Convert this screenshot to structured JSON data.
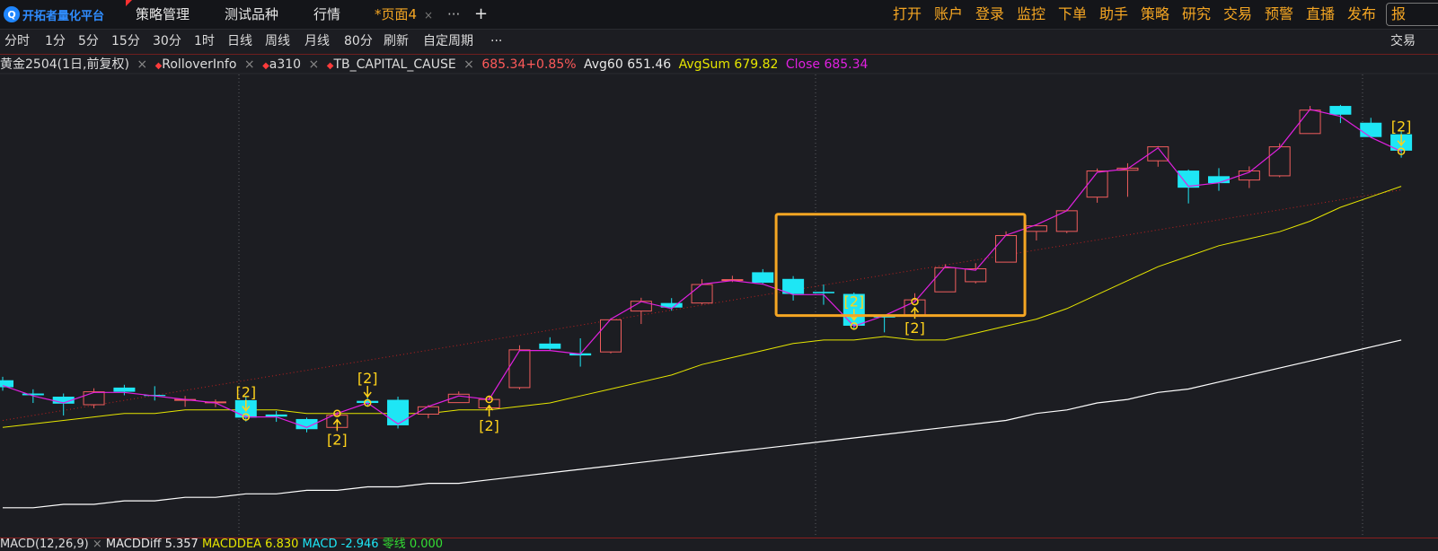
{
  "app": {
    "logo_text": "开拓者量化平台",
    "logo_icon": "q-logo-icon"
  },
  "tabs": [
    {
      "label": "策略管理",
      "active": false
    },
    {
      "label": "测试品种",
      "active": false
    },
    {
      "label": "行情",
      "active": false
    },
    {
      "label": "*页面4",
      "active": true,
      "closable": true
    }
  ],
  "tab_more": "···",
  "tab_add": "+",
  "close_glyph": "×",
  "right_menu": [
    "打开",
    "账户",
    "登录",
    "监控",
    "下单",
    "助手",
    "策略",
    "研究",
    "交易",
    "预警",
    "直播",
    "发布"
  ],
  "right_menu_cut": "报",
  "periods": [
    "分时",
    "1分",
    "5分",
    "15分",
    "30分",
    "1时",
    "日线",
    "周线",
    "月线",
    "80分",
    "刷新",
    "自定周期",
    "···"
  ],
  "period_right": "交易",
  "legend": {
    "symbol": "黄金2504(1日,前复权)",
    "indicators": [
      "RolloverInfo",
      "a310",
      "TB_CAPITAL_CAUSE"
    ],
    "price_change": "685.34+0.85%",
    "avg60": "Avg60 651.46",
    "avgsum": "AvgSum 679.82",
    "close": "Close 685.34",
    "colors": {
      "price_change": "#ff5a5a",
      "avg60": "#e8e8e8",
      "avgsum": "#e6e600",
      "close": "#e020e0"
    }
  },
  "macd_legend": {
    "name": "MACD(12,26,9)",
    "diff": "MACDDiff 5.357",
    "dea": "MACDDEA 6.830",
    "macd": "MACD -2.946",
    "zero": "零线 0.000"
  },
  "chart_data": {
    "type": "candlestick",
    "symbol": "黄金2504",
    "period": "1日",
    "candles": [
      {
        "o": 609.5,
        "h": 610.5,
        "l": 606.5,
        "c": 607.5
      },
      {
        "o": 605.7,
        "h": 606.9,
        "l": 603.0,
        "c": 605.2
      },
      {
        "o": 604.8,
        "h": 605.7,
        "l": 599.4,
        "c": 602.8
      },
      {
        "o": 602.5,
        "h": 607.2,
        "l": 601.5,
        "c": 606.2
      },
      {
        "o": 607.4,
        "h": 608.2,
        "l": 605.2,
        "c": 606.2
      },
      {
        "o": 605.3,
        "h": 607.8,
        "l": 603.7,
        "c": 605.0
      },
      {
        "o": 603.8,
        "h": 605.0,
        "l": 601.9,
        "c": 604.0
      },
      {
        "o": 603.1,
        "h": 604.0,
        "l": 601.8,
        "c": 603.3
      },
      {
        "o": 603.8,
        "h": 604.7,
        "l": 597.7,
        "c": 598.8
      },
      {
        "o": 599.7,
        "h": 600.7,
        "l": 597.6,
        "c": 599.1
      },
      {
        "o": 598.4,
        "h": 598.8,
        "l": 594.6,
        "c": 595.5
      },
      {
        "o": 596.0,
        "h": 600.4,
        "l": 594.9,
        "c": 599.5
      },
      {
        "o": 603.6,
        "h": 604.5,
        "l": 601.9,
        "c": 603.0
      },
      {
        "o": 603.9,
        "h": 604.8,
        "l": 595.7,
        "c": 596.6
      },
      {
        "o": 599.8,
        "h": 602.4,
        "l": 598.6,
        "c": 601.9
      },
      {
        "o": 603.1,
        "h": 606.3,
        "l": 603.1,
        "c": 605.5
      },
      {
        "o": 601.6,
        "h": 605.2,
        "l": 601.3,
        "c": 604.0
      },
      {
        "o": 607.4,
        "h": 619.5,
        "l": 606.9,
        "c": 618.2
      },
      {
        "o": 620.0,
        "h": 621.8,
        "l": 618.2,
        "c": 618.5
      },
      {
        "o": 617.2,
        "h": 621.5,
        "l": 613.4,
        "c": 616.6
      },
      {
        "o": 617.6,
        "h": 627.2,
        "l": 617.2,
        "c": 626.8
      },
      {
        "o": 629.3,
        "h": 633.1,
        "l": 625.6,
        "c": 632.1
      },
      {
        "o": 631.6,
        "h": 633.0,
        "l": 629.4,
        "c": 630.3
      },
      {
        "o": 631.6,
        "h": 638.4,
        "l": 631.2,
        "c": 636.9
      },
      {
        "o": 638.1,
        "h": 639.4,
        "l": 637.6,
        "c": 638.3
      },
      {
        "o": 640.4,
        "h": 641.3,
        "l": 637.2,
        "c": 637.4
      },
      {
        "o": 638.5,
        "h": 639.3,
        "l": 632.3,
        "c": 634.2
      },
      {
        "o": 634.8,
        "h": 636.9,
        "l": 631.1,
        "c": 634.4
      },
      {
        "o": 634.2,
        "h": 634.6,
        "l": 624.2,
        "c": 625.1
      },
      {
        "o": 627.7,
        "h": 628.3,
        "l": 623.2,
        "c": 627.6
      },
      {
        "o": 628.2,
        "h": 634.4,
        "l": 627.3,
        "c": 632.5
      },
      {
        "o": 634.8,
        "h": 642.7,
        "l": 634.8,
        "c": 641.7
      },
      {
        "o": 637.7,
        "h": 643.0,
        "l": 637.2,
        "c": 641.4
      },
      {
        "o": 643.3,
        "h": 652.1,
        "l": 643.3,
        "c": 650.9
      },
      {
        "o": 652.1,
        "h": 653.7,
        "l": 649.5,
        "c": 653.7
      },
      {
        "o": 652.1,
        "h": 658.4,
        "l": 651.6,
        "c": 658.0
      },
      {
        "o": 661.9,
        "h": 670.1,
        "l": 660.3,
        "c": 669.4
      },
      {
        "o": 669.6,
        "h": 671.6,
        "l": 662.0,
        "c": 670.2
      },
      {
        "o": 672.3,
        "h": 676.5,
        "l": 670.6,
        "c": 676.3
      },
      {
        "o": 669.5,
        "h": 669.8,
        "l": 660.1,
        "c": 664.6
      },
      {
        "o": 667.9,
        "h": 670.2,
        "l": 663.7,
        "c": 665.9
      },
      {
        "o": 666.8,
        "h": 670.7,
        "l": 664.5,
        "c": 669.4
      },
      {
        "o": 668.0,
        "h": 677.3,
        "l": 667.6,
        "c": 676.3
      },
      {
        "o": 680.1,
        "h": 688.0,
        "l": 680.1,
        "c": 686.8
      },
      {
        "o": 688.0,
        "h": 688.3,
        "l": 683.1,
        "c": 685.5
      },
      {
        "o": 683.2,
        "h": 684.6,
        "l": 678.9,
        "c": 679.1
      },
      {
        "o": 679.9,
        "h": 680.8,
        "l": 673.2,
        "c": 675.2
      }
    ],
    "series": [
      {
        "name": "Close",
        "values": [
          608,
          605,
          603,
          606,
          606,
          605,
          604,
          603,
          599,
          599,
          596,
          600,
          603,
          597,
          602,
          605,
          604,
          618,
          618,
          617,
          627,
          632,
          630,
          637,
          638,
          637,
          634,
          634,
          625,
          628,
          632,
          642,
          641,
          651,
          654,
          658,
          669,
          670,
          676,
          665,
          666,
          669,
          676,
          687,
          685,
          679,
          675
        ]
      },
      {
        "name": "AvgSum",
        "values": [
          596,
          597,
          598,
          599,
          600,
          600,
          601,
          601,
          601,
          601,
          600,
          600,
          600,
          600,
          600,
          601,
          601,
          602,
          603,
          605,
          607,
          609,
          611,
          614,
          616,
          618,
          620,
          621,
          621,
          622,
          621,
          621,
          623,
          625,
          627,
          630,
          634,
          638,
          642,
          645,
          648,
          650,
          652,
          655,
          659,
          662,
          665
        ]
      },
      {
        "name": "Avg60",
        "values": [
          573,
          573,
          574,
          574,
          575,
          575,
          576,
          576,
          577,
          577,
          578,
          578,
          579,
          579,
          580,
          580,
          581,
          582,
          583,
          584,
          585,
          586,
          587,
          588,
          589,
          590,
          591,
          592,
          593,
          594,
          595,
          596,
          597,
          598,
          600,
          601,
          603,
          604,
          606,
          607,
          609,
          611,
          613,
          615,
          617,
          619,
          621
        ]
      }
    ],
    "signals": [
      {
        "label": "[2]",
        "index": 8,
        "position": "above"
      },
      {
        "label": "[2]",
        "index": 11,
        "position": "below"
      },
      {
        "label": "[2]",
        "index": 12,
        "position": "above"
      },
      {
        "label": "[2]",
        "index": 16,
        "position": "below"
      },
      {
        "label": "[2]",
        "index": 28,
        "position": "above"
      },
      {
        "label": "[2]",
        "index": 30,
        "position": "below"
      },
      {
        "label": "[2]",
        "index": 46,
        "position": "above"
      }
    ],
    "highlight": {
      "from_index": 26,
      "to_index": 33
    },
    "ylim": [
      565,
      697
    ],
    "grid": "vertical dotted",
    "colors": {
      "up": "#f05d5d",
      "down": "#1ee6f5",
      "close": "#e020e0",
      "avgsum": "#e6e600",
      "avg60": "#ffffff",
      "highlight": "#f5a623",
      "signal": "#ffd21a",
      "trend": "#c02020"
    }
  }
}
